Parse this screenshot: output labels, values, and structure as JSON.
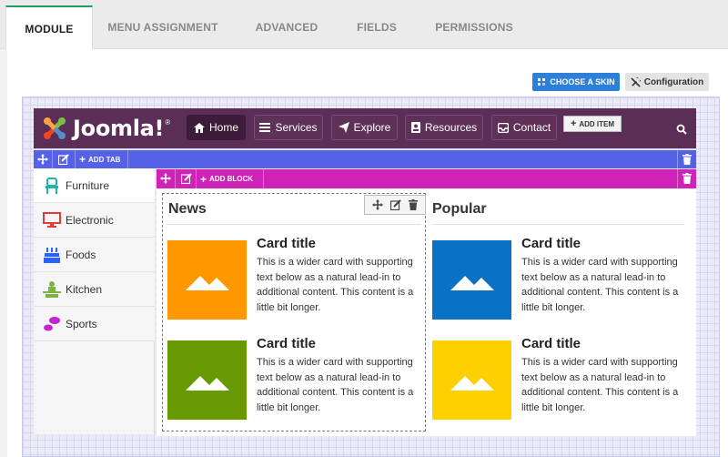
{
  "tabs": [
    "MODULE",
    "MENU ASSIGNMENT",
    "ADVANCED",
    "FIELDS",
    "PERMISSIONS"
  ],
  "toolbar": {
    "choose_skin": "CHOOSE A SKIN",
    "configuration": "Configuration"
  },
  "menu": {
    "logo_text": "Joomla!",
    "logo_mark": "®",
    "items": [
      "Home",
      "Services",
      "Explore",
      "Resources",
      "Contact"
    ],
    "add_item": "ADD ITEM"
  },
  "tab_bar": {
    "add_tab": "ADD TAB"
  },
  "block_bar": {
    "add_block": "ADD BLOCK"
  },
  "sidebar": {
    "items": [
      {
        "label": "Furniture",
        "icon": "chair-icon",
        "color": "#1fb3a5"
      },
      {
        "label": "Electronic",
        "icon": "monitor-icon",
        "color": "#e53935"
      },
      {
        "label": "Foods",
        "icon": "cake-icon",
        "color": "#2962ff"
      },
      {
        "label": "Kitchen",
        "icon": "chef-icon",
        "color": "#7cb342"
      },
      {
        "label": "Sports",
        "icon": "footprints-icon",
        "color": "#c026d3"
      }
    ]
  },
  "columns": [
    {
      "title": "News",
      "cards": [
        {
          "title": "Card title",
          "text": "This is a wider card with supporting text below as a natural lead-in to additional content. This content is a little bit longer.",
          "color": "#ff9800"
        },
        {
          "title": "Card title",
          "text": "This is a wider card with supporting text below as a natural lead-in to additional content. This content is a little bit longer.",
          "color": "#669a00"
        }
      ]
    },
    {
      "title": "Popular",
      "cards": [
        {
          "title": "Card title",
          "text": "This is a wider card with supporting text below as a natural lead-in to additional content. This content is a little bit longer.",
          "color": "#0a72c4"
        },
        {
          "title": "Card title",
          "text": "This is a wider card with supporting text below as a natural lead-in to additional content. This content is a little bit longer.",
          "color": "#ffd000"
        }
      ]
    }
  ],
  "colors": {
    "menu_bg": "#5a2e57",
    "tab_bar": "#5561e6",
    "block_bar": "#cf22b6",
    "skin_button": "#2d7fd8",
    "active_tab_accent": "#1aa260"
  }
}
